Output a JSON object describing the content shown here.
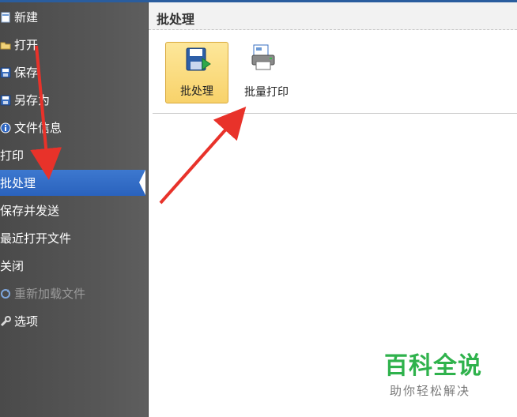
{
  "sidebar": {
    "items": [
      {
        "label": "新建",
        "icon": "new-document-icon"
      },
      {
        "label": "打开",
        "icon": "open-folder-icon"
      },
      {
        "label": "保存",
        "icon": "save-icon"
      },
      {
        "label": "另存为",
        "icon": "save-as-icon"
      },
      {
        "label": "文件信息",
        "icon": "info-icon"
      },
      {
        "label": "打印"
      },
      {
        "label": "批处理",
        "active": true
      },
      {
        "label": "保存并发送"
      },
      {
        "label": "最近打开文件"
      },
      {
        "label": "关闭"
      },
      {
        "label": "重新加载文件",
        "icon": "reload-icon",
        "disabled": true
      },
      {
        "label": "选项",
        "icon": "options-wrench-icon"
      }
    ]
  },
  "main": {
    "title": "批处理",
    "tiles": [
      {
        "label": "批处理",
        "icon": "batch-save-icon",
        "selected": true
      },
      {
        "label": "批量打印",
        "icon": "batch-print-icon"
      }
    ]
  },
  "watermark": {
    "main": "百科全说",
    "sub": "助你轻松解决"
  },
  "colors": {
    "sidebar_bg": "#555555",
    "active_bg": "#2f6ac4",
    "selected_tile": "#f8d26a",
    "arrow": "#e8322a",
    "watermark": "#2fb24c"
  }
}
